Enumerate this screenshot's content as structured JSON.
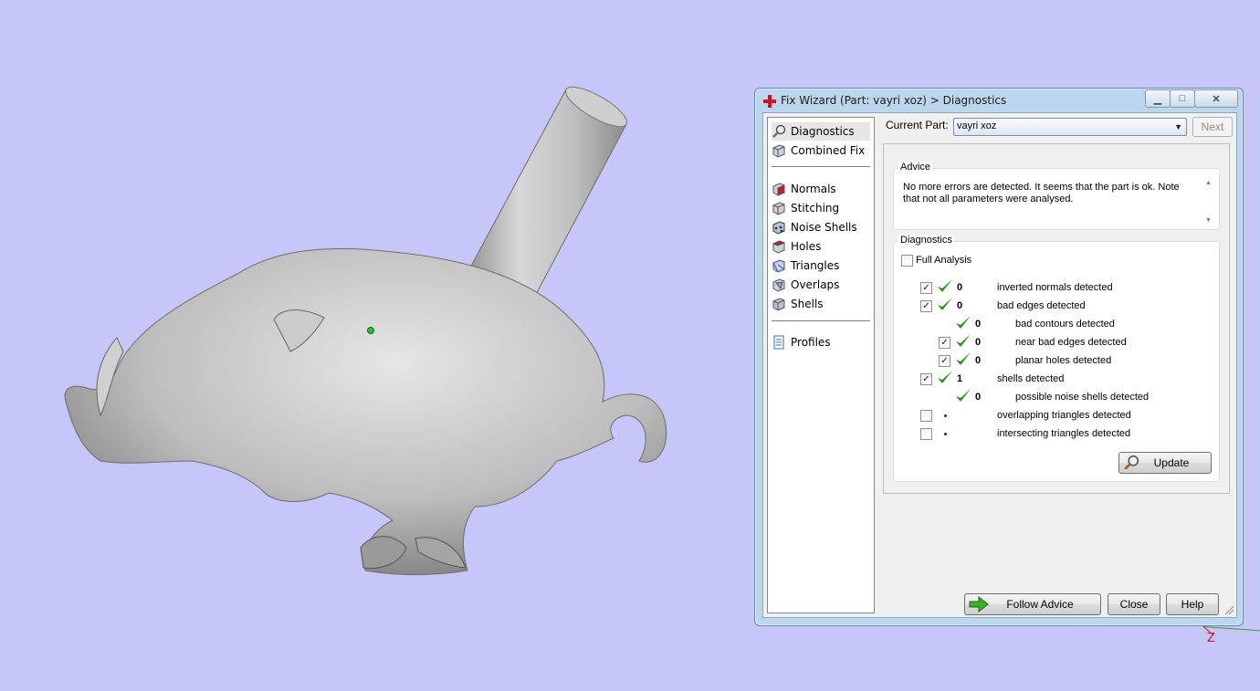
{
  "window": {
    "title": "Fix Wizard (Part: vayri xoz) > Diagnostics",
    "controls": [
      "minimize-icon",
      "maximize-icon",
      "close-icon"
    ]
  },
  "nav": {
    "items": [
      {
        "label": "Diagnostics",
        "icon": "magnifier-icon",
        "selected": true
      },
      {
        "label": "Combined Fix",
        "icon": "cube-icon"
      },
      {
        "label": "Normals",
        "icon": "cube-red-face-icon"
      },
      {
        "label": "Stitching",
        "icon": "cube-stitch-icon"
      },
      {
        "label": "Noise Shells",
        "icon": "noise-cube-icon"
      },
      {
        "label": "Holes",
        "icon": "cube-hole-icon"
      },
      {
        "label": "Triangles",
        "icon": "triangle-cube-icon"
      },
      {
        "label": "Overlaps",
        "icon": "overlap-cube-icon"
      },
      {
        "label": "Shells",
        "icon": "shell-cube-icon"
      },
      {
        "label": "Profiles",
        "icon": "document-icon"
      }
    ]
  },
  "current_part": {
    "label": "Current Part:",
    "value": "vayri xoz",
    "next_label": "Next"
  },
  "advice": {
    "title": "Advice",
    "text": "No more errors are detected. It seems that the part is ok. Note that not all parameters were analysed."
  },
  "diagnostics": {
    "title": "Diagnostics",
    "full_analysis_label": "Full Analysis",
    "full_analysis_checked": false,
    "rows": [
      {
        "checkbox": true,
        "checked": true,
        "status": "ok",
        "count": "0",
        "text": "inverted normals detected"
      },
      {
        "checkbox": true,
        "checked": true,
        "status": "ok",
        "count": "0",
        "text": "bad edges detected"
      },
      {
        "checkbox": false,
        "checked": false,
        "status": "ok",
        "count": "0",
        "text": "bad contours detected"
      },
      {
        "checkbox": true,
        "checked": true,
        "status": "ok",
        "count": "0",
        "text": "near bad edges detected"
      },
      {
        "checkbox": true,
        "checked": true,
        "status": "ok",
        "count": "0",
        "text": "planar holes detected"
      },
      {
        "checkbox": true,
        "checked": true,
        "status": "ok",
        "count": "1",
        "text": "shells detected"
      },
      {
        "checkbox": false,
        "checked": false,
        "status": "ok",
        "count": "0",
        "text": "possible noise shells detected"
      },
      {
        "checkbox": true,
        "checked": false,
        "status": "pending",
        "count": "",
        "text": "overlapping triangles detected"
      },
      {
        "checkbox": true,
        "checked": false,
        "status": "pending",
        "count": "",
        "text": "intersecting triangles detected"
      }
    ],
    "update_label": "Update"
  },
  "footer": {
    "follow_advice_label": "Follow Advice",
    "close_label": "Close",
    "help_label": "Help"
  },
  "viewport": {
    "axis_label": "Z",
    "background": "#c6c6f8"
  }
}
